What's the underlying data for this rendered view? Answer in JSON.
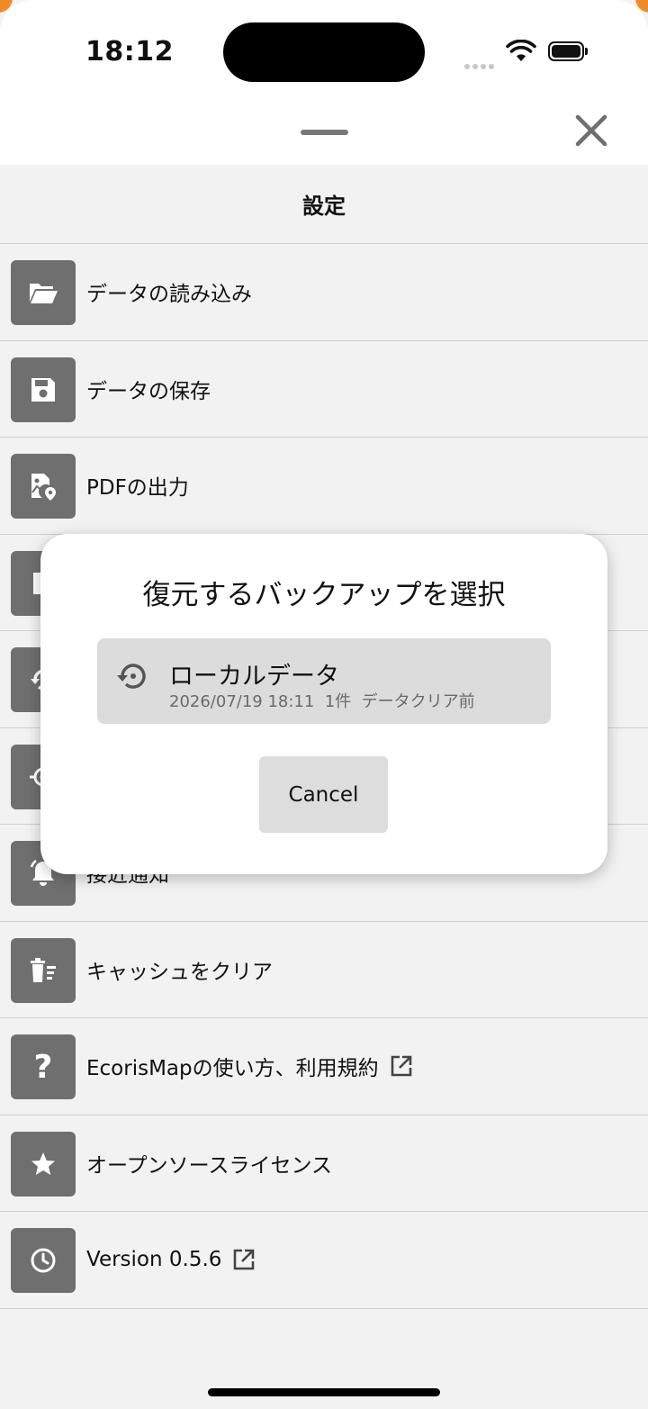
{
  "status": {
    "time": "18:12",
    "icons": [
      "cellular-signal-icon",
      "wifi-icon",
      "battery-icon"
    ]
  },
  "sheet": {
    "title": "設定",
    "close_icon": "close-icon"
  },
  "menu": {
    "items": [
      {
        "label": "データの読み込み",
        "icon": "folder-open-icon"
      },
      {
        "label": "データの保存",
        "icon": "floppy-disk-icon"
      },
      {
        "label": "PDFの出力",
        "icon": "map-image-icon"
      },
      {
        "label": "",
        "icon": "document-icon"
      },
      {
        "label": "",
        "icon": "restore-icon"
      },
      {
        "label": "",
        "icon": "location-target-icon"
      },
      {
        "label": "接近通知",
        "icon": "bell-icon"
      },
      {
        "label": "キャッシュをクリア",
        "icon": "trash-list-icon"
      },
      {
        "label": "EcorisMapの使い方、利用規約",
        "icon": "question-icon",
        "external": true
      },
      {
        "label": "オープンソースライセンス",
        "icon": "star-icon"
      },
      {
        "label": "Version 0.5.6",
        "icon": "clock-icon",
        "external": true
      }
    ]
  },
  "dialog": {
    "title": "復元するバックアップを選択",
    "backup": {
      "name": "ローカルデータ",
      "meta": "2026/07/19 18:11  1件  データクリア前",
      "icon": "restore-history-icon"
    },
    "cancel_label": "Cancel"
  },
  "colors": {
    "icon_bg": "#6f6f6f",
    "list_bg": "#f2f2f2",
    "dialog_bg": "#ffffff",
    "backup_bg": "#dcdcdc",
    "accent": "#f08a24"
  }
}
